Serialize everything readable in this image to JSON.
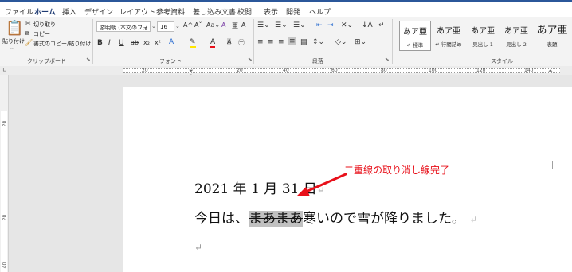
{
  "tabs": [
    "ファイル",
    "ホーム",
    "挿入",
    "デザイン",
    "レイアウト",
    "参考資料",
    "差し込み文書",
    "校閲",
    "表示",
    "開発",
    "ヘルプ"
  ],
  "ribbon": {
    "clipboard": {
      "paste_label": "貼り付け",
      "cut_label": "切り取り",
      "copy_label": "コピー",
      "format_painter_label": "書式のコピー/貼り付け",
      "group_label": "クリップボード"
    },
    "font": {
      "font_name": "游明朝 (本文のフォ",
      "font_size": "16",
      "group_label": "フォント"
    },
    "paragraph": {
      "group_label": "段落"
    },
    "styles": {
      "items": [
        {
          "preview": "あア亜",
          "name": "↵ 標準"
        },
        {
          "preview": "あア亜",
          "name": "↵ 行間詰め"
        },
        {
          "preview": "あア亜",
          "name": "見出し 1"
        },
        {
          "preview": "あア亜",
          "name": "見出し 2"
        },
        {
          "preview": "あア亜",
          "name": "表題"
        }
      ],
      "group_label": "スタイル"
    }
  },
  "ruler": {
    "numbers": [
      "20",
      "20",
      "40",
      "60",
      "80",
      "100",
      "120",
      "140"
    ]
  },
  "vruler": {
    "numbers": [
      "20",
      "20",
      "40"
    ]
  },
  "document": {
    "line1": "2021 年 1 月 31 日",
    "line2_before": "今日は、",
    "line2_struck": "まあまあ",
    "line2_after": "寒いので雪が降りました。",
    "paragraph_mark": "↵"
  },
  "annotation": {
    "text": "二重線の取り消し線完了",
    "color": "#e8101a"
  },
  "colors": {
    "accent": "#2b579a",
    "ribbon_bg": "#f3f3f3",
    "workspace": "#e6e6e6"
  }
}
